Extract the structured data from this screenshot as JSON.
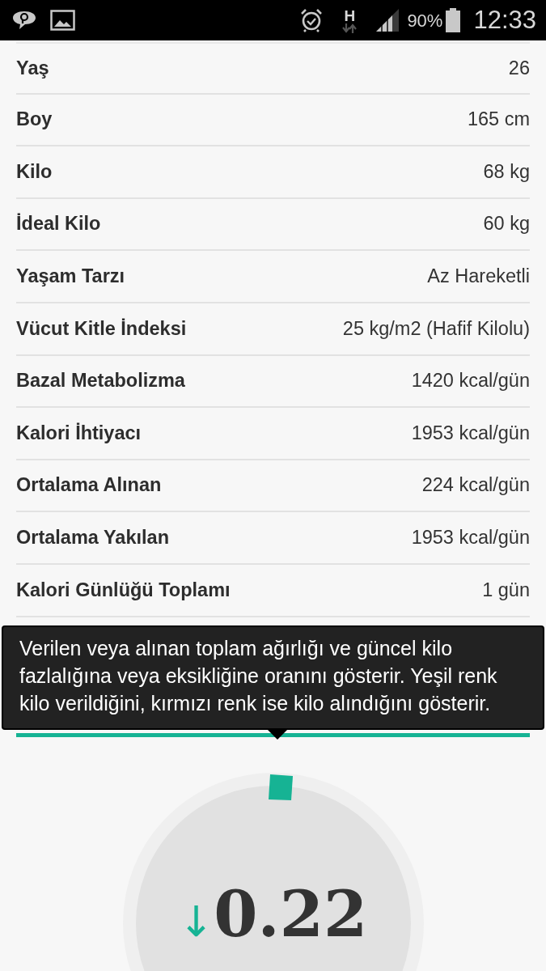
{
  "status_bar": {
    "network_type": "H",
    "battery": "90%",
    "time": "12:33"
  },
  "rows": [
    {
      "label": "Yaş",
      "value": "26"
    },
    {
      "label": "Boy",
      "value": "165 cm"
    },
    {
      "label": "Kilo",
      "value": "68 kg"
    },
    {
      "label": "İdeal Kilo",
      "value": "60 kg"
    },
    {
      "label": "Yaşam Tarzı",
      "value": "Az Hareketli"
    },
    {
      "label": "Vücut Kitle İndeksi",
      "value": "25 kg/m2 (Hafif Kilolu)"
    },
    {
      "label": "Bazal Metabolizma",
      "value": "1420 kcal/gün"
    },
    {
      "label": "Kalori İhtiyacı",
      "value": "1953 kcal/gün"
    },
    {
      "label": "Ortalama Alınan",
      "value": "224 kcal/gün"
    },
    {
      "label": "Ortalama Yakılan",
      "value": "1953 kcal/gün"
    },
    {
      "label": "Kalori Günlüğü Toplamı",
      "value": "1 gün"
    }
  ],
  "tooltip": {
    "text": "Verilen veya alınan toplam ağırlığı ve güncel kilo fazlalığına veya eksikliğine oranını gösterir. Yeşil renk kilo verildiğini, kırmızı renk ise kilo alındığını gösterir."
  },
  "gauge": {
    "arrow": "↓",
    "value": "0.22"
  }
}
